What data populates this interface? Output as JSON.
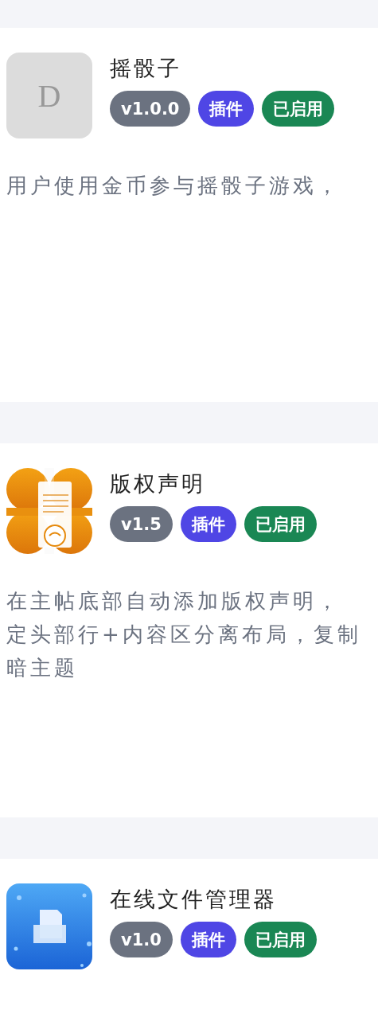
{
  "plugins": [
    {
      "icon": {
        "kind": "letter",
        "letter": "D"
      },
      "name": "摇骰子",
      "badges": [
        {
          "text": "v1.0.0",
          "color": "#6b7280"
        },
        {
          "text": "插件",
          "color": "#4f46e5"
        },
        {
          "text": "已启用",
          "color": "#1a8754"
        }
      ],
      "description": [
        "用户使用金币参与摇骰子游戏，"
      ]
    },
    {
      "icon": {
        "kind": "document"
      },
      "name": "版权声明",
      "badges": [
        {
          "text": "v1.5",
          "color": "#6b7280"
        },
        {
          "text": "插件",
          "color": "#4f46e5"
        },
        {
          "text": "已启用",
          "color": "#1a8754"
        }
      ],
      "description": [
        "在主帖底部自动添加版权声明，",
        "定头部行+内容区分离布局，复制",
        "暗主题"
      ]
    },
    {
      "icon": {
        "kind": "folder"
      },
      "name": "在线文件管理器",
      "badges": [
        {
          "text": "v1.0",
          "color": "#6b7280"
        },
        {
          "text": "插件",
          "color": "#4f46e5"
        },
        {
          "text": "已启用",
          "color": "#1a8754"
        }
      ]
    }
  ]
}
